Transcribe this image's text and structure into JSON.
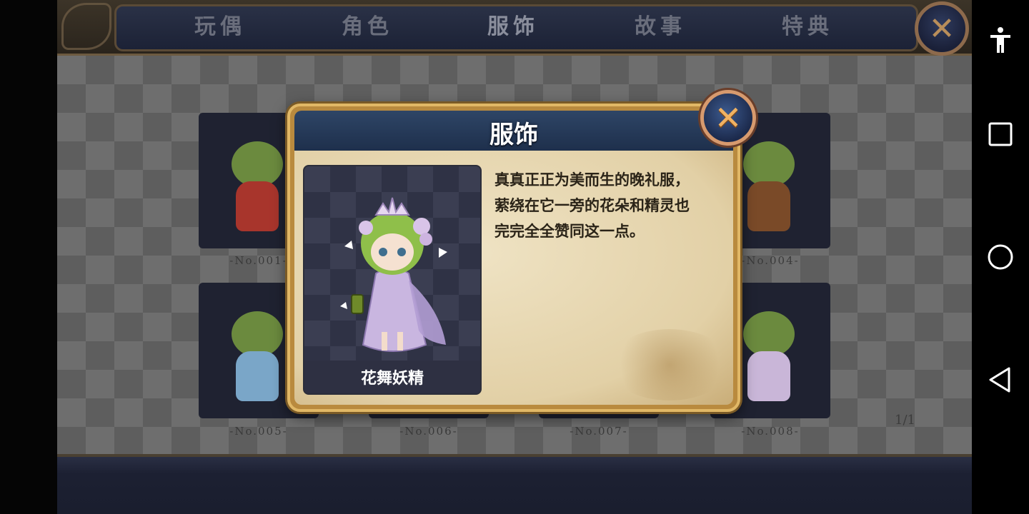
{
  "tabs": [
    {
      "label": "玩偶",
      "active": false
    },
    {
      "label": "角色",
      "active": false
    },
    {
      "label": "服饰",
      "active": true
    },
    {
      "label": "故事",
      "active": false
    },
    {
      "label": "特典",
      "active": false
    }
  ],
  "grid": {
    "cards": [
      {
        "number": "-No.001-",
        "accent": "#a8352c"
      },
      {
        "number": "-No.004-",
        "accent": "#7a4a28"
      },
      {
        "number": "-No.005-",
        "accent": "#7aa6c8"
      },
      {
        "number": "-No.006-",
        "accent": "#555"
      },
      {
        "number": "-No.007-",
        "accent": "#555"
      },
      {
        "number": "-No.008-",
        "accent": "#c9b6d8"
      }
    ],
    "page_indicator": "1/1"
  },
  "modal": {
    "title": "服饰",
    "costume_name": "花舞妖精",
    "description_lines": [
      "真真正正为美而生的晚礼服，",
      "萦绕在它一旁的花朵和精灵也",
      "完完全全赞同这一点。"
    ]
  },
  "icons": {
    "top_close": "close-icon",
    "modal_close": "close-icon",
    "nav": [
      "accessibility-icon",
      "recents-icon",
      "home-icon",
      "back-icon"
    ]
  },
  "colors": {
    "modal_frame": "#e1b866",
    "modal_header": "#2e4566",
    "parchment": "#efe3c4",
    "close_accent": "#f0b262"
  }
}
